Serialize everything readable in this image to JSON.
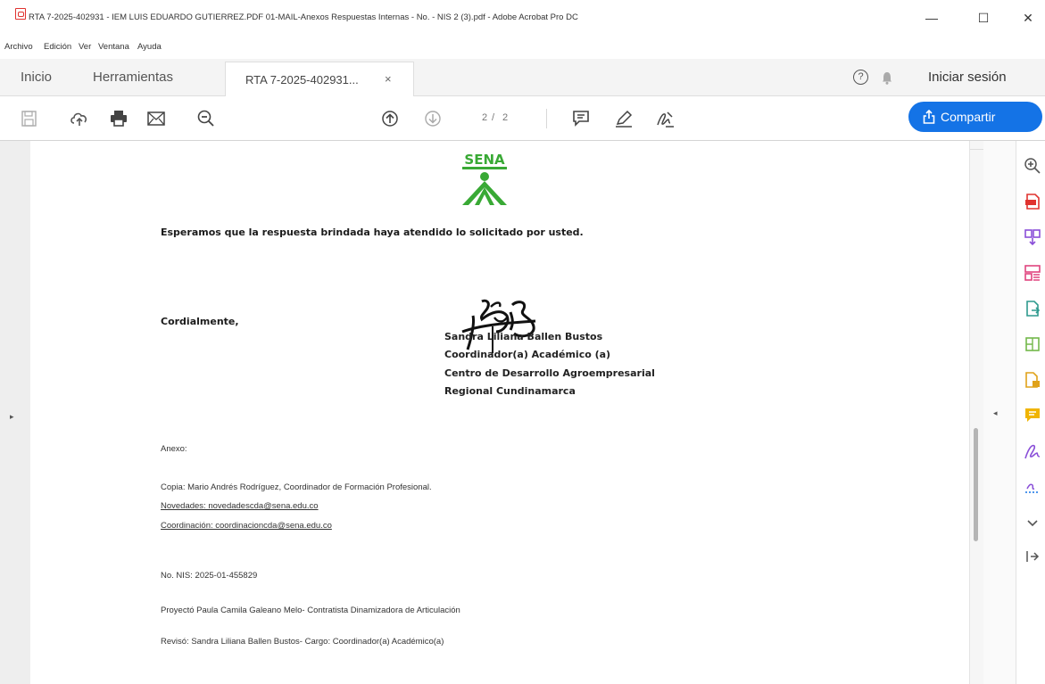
{
  "window": {
    "title": "RTA 7-2025-402931 - IEM LUIS EDUARDO GUTIERREZ.PDF 01-MAIL-Anexos Respuestas Internas - No. - NIS 2 (3).pdf - Adobe Acrobat Pro DC",
    "minimize": "—",
    "maximize": "☐",
    "close": "✕"
  },
  "menu": {
    "items": [
      "Archivo",
      "Edición",
      "Ver",
      "Ventana",
      "Ayuda"
    ]
  },
  "tabs": {
    "home": "Inicio",
    "tools": "Herramientas",
    "document": "RTA 7-2025-402931...",
    "document_close": "×",
    "help": "?",
    "signin": "Iniciar sesión"
  },
  "toolbar": {
    "page_current": "2",
    "page_separator": "/",
    "page_total": "2",
    "share_label": "Compartir",
    "share_color": "#1473e6"
  },
  "document": {
    "logo_text": "SENA",
    "logo_color": "#39a935",
    "line1": "Esperamos que la respuesta brindada haya atendido lo solicitado por usted.",
    "closing": "Cordialmente,",
    "signer_name": "Sandra Liliana Ballen Bustos",
    "signer_role": "Coordinador(a) Académico (a)",
    "signer_center": "Centro de Desarrollo Agroempresarial",
    "signer_region": "Regional Cundinamarca",
    "annex": "Anexo:",
    "copy": "Copia: Mario Andrés Rodríguez, Coordinador de Formación Profesional.",
    "novedades": "Novedades: novedadescda@sena.edu.co",
    "coordinacion": "Coordinación: coordinacioncda@sena.edu.co",
    "nis": "No. NIS: 2025-01-455829",
    "projected": "Proyectó Paula Camila Galeano Melo- Contratista Dinamizadora de Articulación",
    "reviewed": "Revisó: Sandra Liliana Ballen Bustos- Cargo: Coordinador(a) Académico(a)"
  },
  "panels": {
    "left_toggle": "▸",
    "right_toggle": "◂"
  },
  "icons": {
    "toolbar": [
      "save-icon",
      "upload-cloud-icon",
      "print-icon",
      "email-icon",
      "zoom-out-icon",
      "page-up-icon",
      "page-down-icon",
      "comment-icon",
      "highlight-pen-icon",
      "sign-icon"
    ],
    "right_tools": [
      "zoom-icon",
      "export-pdf-icon",
      "combine-files-icon",
      "organize-pages-icon",
      "edit-pdf-icon",
      "create-pdf-icon",
      "export-file-icon",
      "comment-icon",
      "fill-sign-icon",
      "request-signature-icon",
      "more-tools-icon",
      "collapse-panel-icon"
    ]
  }
}
